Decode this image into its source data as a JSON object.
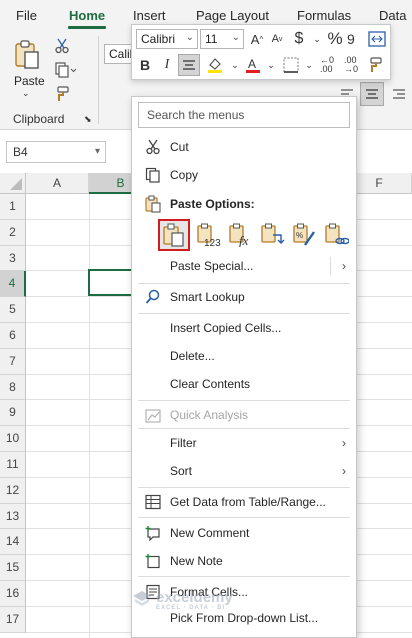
{
  "ribbon_tabs": [
    "File",
    "Home",
    "Insert",
    "Page Layout",
    "Formulas",
    "Data"
  ],
  "active_tab": "Home",
  "clipboard": {
    "paste_label": "Paste",
    "group_label": "Clipboard"
  },
  "font_ribbon_partial": "Calib",
  "mini_toolbar": {
    "font_name": "Calibri",
    "font_size": "11",
    "currency_symbol": "$",
    "percent_symbol": "%",
    "bold": "B",
    "italic": "I"
  },
  "name_box": "B4",
  "columns": [
    "A",
    "B",
    "F"
  ],
  "selected_column": "B",
  "rows": [
    "1",
    "2",
    "3",
    "4",
    "5",
    "6",
    "7",
    "8",
    "9",
    "10",
    "11",
    "12",
    "13",
    "14",
    "15",
    "16",
    "17"
  ],
  "selected_row": "4",
  "context_menu": {
    "search_placeholder": "Search the menus",
    "cut": "Cut",
    "copy": "Copy",
    "paste_options": "Paste Options:",
    "paste_special": "Paste Special...",
    "smart_lookup": "Smart Lookup",
    "insert_copied_cells": "Insert Copied Cells...",
    "delete": "Delete...",
    "clear_contents": "Clear Contents",
    "quick_analysis": "Quick Analysis",
    "filter": "Filter",
    "sort": "Sort",
    "get_data": "Get Data from Table/Range...",
    "new_comment": "New Comment",
    "new_note": "New Note",
    "format_cells": "Format Cells...",
    "pick_from_list": "Pick From Drop-down List..."
  },
  "watermark": {
    "name": "exceldemy",
    "tagline": "EXCEL · DATA · BI"
  },
  "colors": {
    "accent": "#1e6c41",
    "paste_selected_border": "#d41c1c"
  }
}
